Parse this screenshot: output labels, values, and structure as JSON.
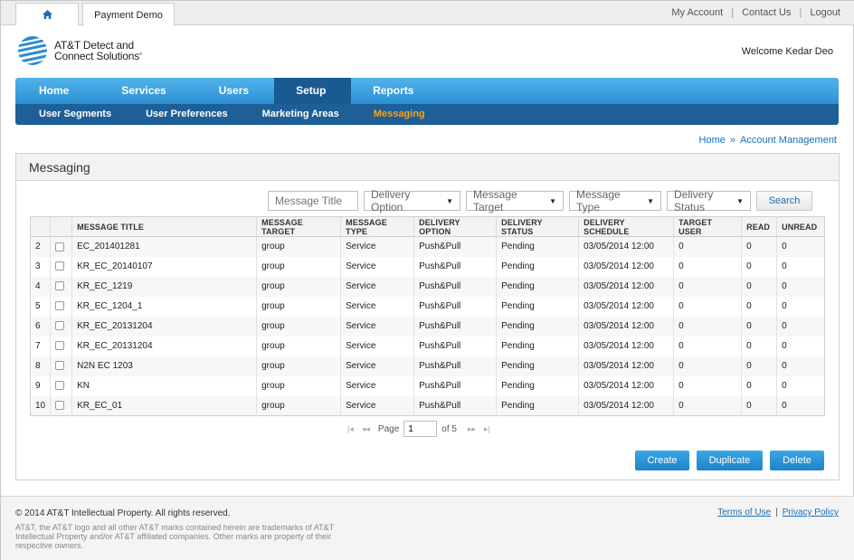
{
  "colors": {
    "accent": "#2b8fd3",
    "nav_active": "#1a5a92",
    "sub_active": "#f7a21b",
    "link": "#1b6eb5"
  },
  "topbar": {
    "home_icon": "home-icon",
    "app_tab": "Payment Demo",
    "links": [
      "My Account",
      "Contact Us",
      "Logout"
    ]
  },
  "brand": {
    "line1": "AT&T Detect and",
    "line2": "Connect Solutions",
    "mark": "°"
  },
  "welcome": "Welcome Kedar Deo",
  "nav": {
    "main": [
      "Home",
      "Services",
      "Users",
      "Setup",
      "Reports"
    ],
    "active_main": "Setup",
    "sub": [
      "User Segments",
      "User Preferences",
      "Marketing Areas",
      "Messaging"
    ],
    "active_sub": "Messaging"
  },
  "breadcrumb": {
    "home": "Home",
    "sep": "»",
    "current": "Account Management"
  },
  "panel": {
    "title": "Messaging"
  },
  "filters": {
    "title_placeholder": "Message Title",
    "delivery_option": "Delivery Option",
    "message_target": "Message Target",
    "message_type": "Message Type",
    "delivery_status": "Delivery Status",
    "search_label": "Search"
  },
  "table": {
    "headers": [
      "",
      "",
      "MESSAGE TITLE",
      "MESSAGE TARGET",
      "MESSAGE TYPE",
      "DELIVERY OPTION",
      "DELIVERY STATUS",
      "DELIVERY SCHEDULE",
      "TARGET USER",
      "READ",
      "UNREAD"
    ],
    "rows": [
      [
        "2",
        "EC_201401281",
        "group",
        "Service",
        "Push&Pull",
        "Pending",
        "03/05/2014 12:00",
        "0",
        "0",
        "0"
      ],
      [
        "3",
        "KR_EC_20140107",
        "group",
        "Service",
        "Push&Pull",
        "Pending",
        "03/05/2014 12:00",
        "0",
        "0",
        "0"
      ],
      [
        "4",
        "KR_EC_1219",
        "group",
        "Service",
        "Push&Pull",
        "Pending",
        "03/05/2014 12:00",
        "0",
        "0",
        "0"
      ],
      [
        "5",
        "KR_EC_1204_1",
        "group",
        "Service",
        "Push&Pull",
        "Pending",
        "03/05/2014 12:00",
        "0",
        "0",
        "0"
      ],
      [
        "6",
        "KR_EC_20131204",
        "group",
        "Service",
        "Push&Pull",
        "Pending",
        "03/05/2014 12:00",
        "0",
        "0",
        "0"
      ],
      [
        "7",
        "KR_EC_20131204",
        "group",
        "Service",
        "Push&Pull",
        "Pending",
        "03/05/2014 12:00",
        "0",
        "0",
        "0"
      ],
      [
        "8",
        "N2N EC 1203",
        "group",
        "Service",
        "Push&Pull",
        "Pending",
        "03/05/2014 12:00",
        "0",
        "0",
        "0"
      ],
      [
        "9",
        "KN",
        "group",
        "Service",
        "Push&Pull",
        "Pending",
        "03/05/2014 12:00",
        "0",
        "0",
        "0"
      ],
      [
        "10",
        "KR_EC_01",
        "group",
        "Service",
        "Push&Pull",
        "Pending",
        "03/05/2014 12:00",
        "0",
        "0",
        "0"
      ]
    ]
  },
  "pager": {
    "page_label": "Page",
    "page": "1",
    "of_label": "of 5"
  },
  "actions": {
    "create": "Create",
    "duplicate": "Duplicate",
    "delete": "Delete"
  },
  "footer": {
    "copyright": "© 2014 AT&T Intellectual Property. All rights reserved.",
    "disclaimer": "AT&T, the AT&T logo and all other AT&T marks contained herein are trademarks of AT&T Intellectual Property and/or AT&T affiliated companies. Other marks are property of their respective owners.",
    "terms": "Terms of Use",
    "sep": "|",
    "privacy": "Privacy Policy"
  }
}
